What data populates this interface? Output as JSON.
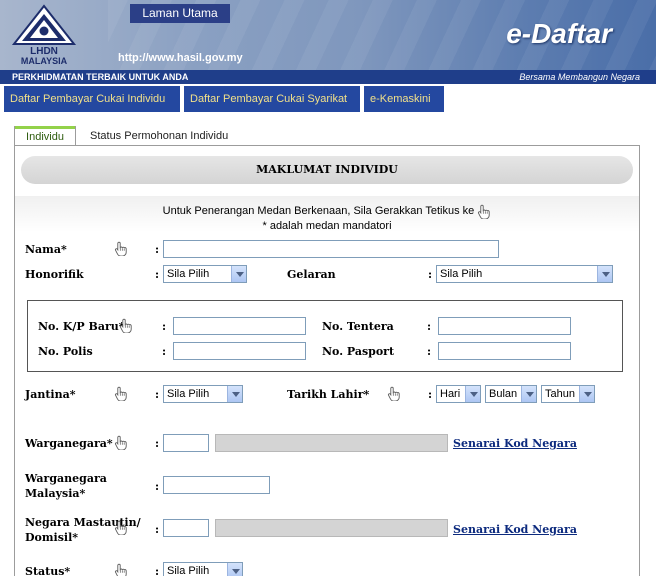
{
  "header": {
    "logo_text_top": "LHDN",
    "logo_text_bottom": "MALAYSIA",
    "home_tab": "Laman Utama",
    "url": "http://www.hasil.gov.my",
    "brand": "e-Daftar",
    "tagline_left": "PERKHIDMATAN TERBAIK UNTUK ANDA",
    "tagline_right": "Bersama Membangun Negara"
  },
  "nav": {
    "items": [
      {
        "label": "Daftar Pembayar Cukai Individu"
      },
      {
        "label": "Daftar Pembayar Cukai Syarikat"
      },
      {
        "label": "e-Kemaskini"
      }
    ]
  },
  "subtabs": {
    "active": "Individu",
    "other": "Status Permohonan Individu"
  },
  "form": {
    "section_title": "MAKLUMAT INDIVIDU",
    "instruction_line1": "Untuk Penerangan Medan Berkenaan, Sila Gerakkan Tetikus ke",
    "instruction_line2": "* adalah medan mandatori",
    "colon": ":",
    "nama": {
      "label": "Nama*",
      "value": ""
    },
    "honorifik": {
      "label": "Honorifik",
      "selected": "Sila Pilih"
    },
    "gelaran": {
      "label": "Gelaran",
      "selected": "Sila Pilih"
    },
    "kp_baru": {
      "label": "No. K/P Baru*",
      "value": ""
    },
    "tentera": {
      "label": "No. Tentera",
      "value": ""
    },
    "polis": {
      "label": "No. Polis",
      "value": ""
    },
    "pasport": {
      "label": "No. Pasport",
      "value": ""
    },
    "jantina": {
      "label": "Jantina*",
      "selected": "Sila Pilih"
    },
    "tarikh_lahir": {
      "label": "Tarikh Lahir*",
      "day": "Hari",
      "month": "Bulan",
      "year": "Tahun"
    },
    "warganegara": {
      "label": "Warganegara*",
      "link": "Senarai Kod Negara"
    },
    "warganegara_my": {
      "label_line1": "Warganegara",
      "label_line2": "Malaysia*"
    },
    "negara_mastautin": {
      "label_line1": "Negara Mastautin/",
      "label_line2": "Domisil*",
      "link": "Senarai Kod Negara"
    },
    "status": {
      "label": "Status*",
      "selected": "Sila Pilih"
    }
  },
  "colors": {
    "banner_dark": "#1f3e8a",
    "nav_bg": "#2448a0",
    "nav_text": "#f1e08a",
    "tab_accent": "#93d24a",
    "link": "#0c2a7e"
  },
  "icons": {
    "hand": "pointer-hand-icon",
    "select_arrow": "chevron-down-icon",
    "logo": "lhdn-logo"
  }
}
